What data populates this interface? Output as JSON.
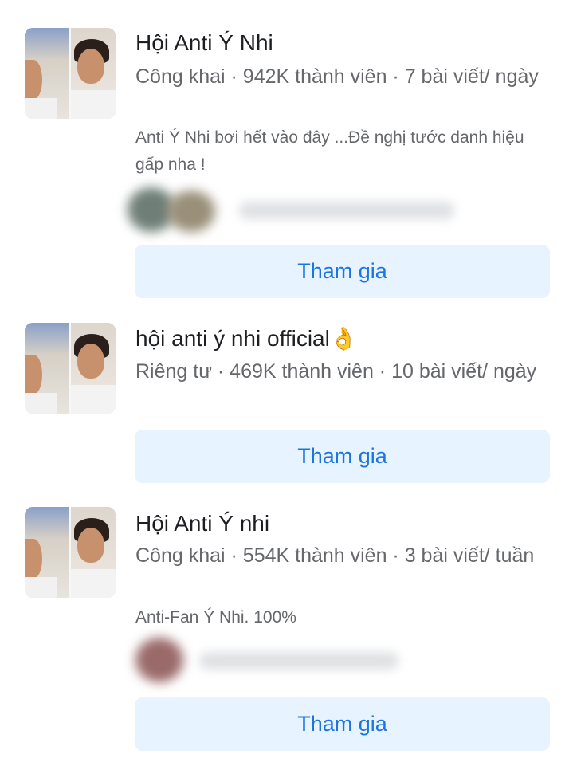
{
  "groups": [
    {
      "name": "Hội Anti Ý Nhi",
      "meta": "Công khai · 942K thành viên · 7 bài viết/ ngày",
      "description": "Anti Ý Nhi bơi hết vào đây ...Đề nghị tước danh hiệu gấp nha !",
      "join_label": "Tham gia"
    },
    {
      "name": "hội anti ý nhi official",
      "name_emoji": "👌",
      "meta": "Riêng tư · 469K thành viên · 10 bài viết/ ngày",
      "join_label": "Tham gia"
    },
    {
      "name": "Hội Anti Ý nhi",
      "meta": "Công khai · 554K thành viên · 3 bài viết/ tuần",
      "description": "Anti-Fan Ý Nhi. 100%",
      "join_label": "Tham gia"
    }
  ],
  "colors": {
    "button_bg": "#e7f3ff",
    "button_text": "#1b74e4",
    "meta_text": "#65676b"
  }
}
